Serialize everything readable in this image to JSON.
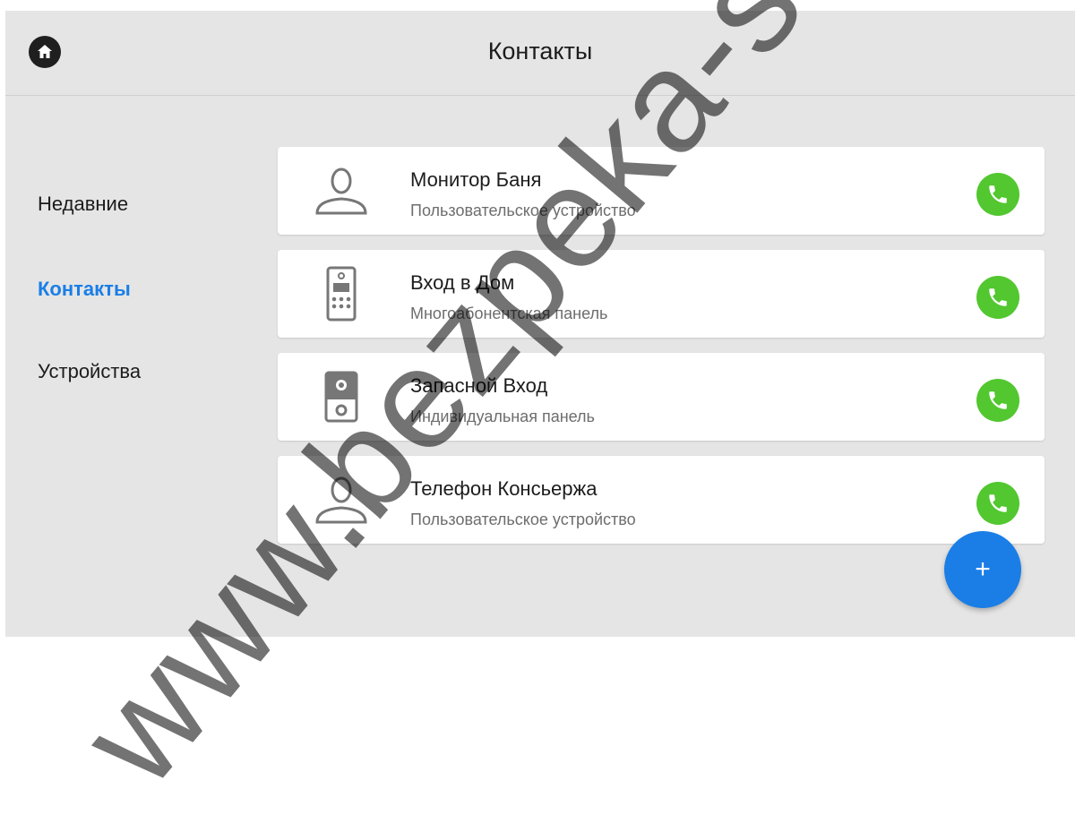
{
  "header": {
    "title": "Контакты"
  },
  "sidebar": {
    "items": [
      {
        "label": "Недавние",
        "active": false
      },
      {
        "label": "Контакты",
        "active": true
      },
      {
        "label": "Устройства",
        "active": false
      }
    ]
  },
  "contacts": [
    {
      "name": "Монитор Баня",
      "type": "Пользовательское устройство",
      "icon": "person-icon"
    },
    {
      "name": "Вход в Дом",
      "type": "Многоабонентская панель",
      "icon": "multi-apartment-panel-icon"
    },
    {
      "name": "Запасной Вход",
      "type": "Индивидуальная панель",
      "icon": "individual-panel-icon"
    },
    {
      "name": "Телефон Консьержа",
      "type": "Пользовательское устройство",
      "icon": "person-icon"
    }
  ],
  "fab": {
    "label": "+"
  },
  "watermark": {
    "text": "www.bezpeka-s"
  },
  "colors": {
    "accent": "#1a7ee6",
    "call": "#52c72f",
    "background": "#e5e5e5",
    "card": "#ffffff"
  }
}
